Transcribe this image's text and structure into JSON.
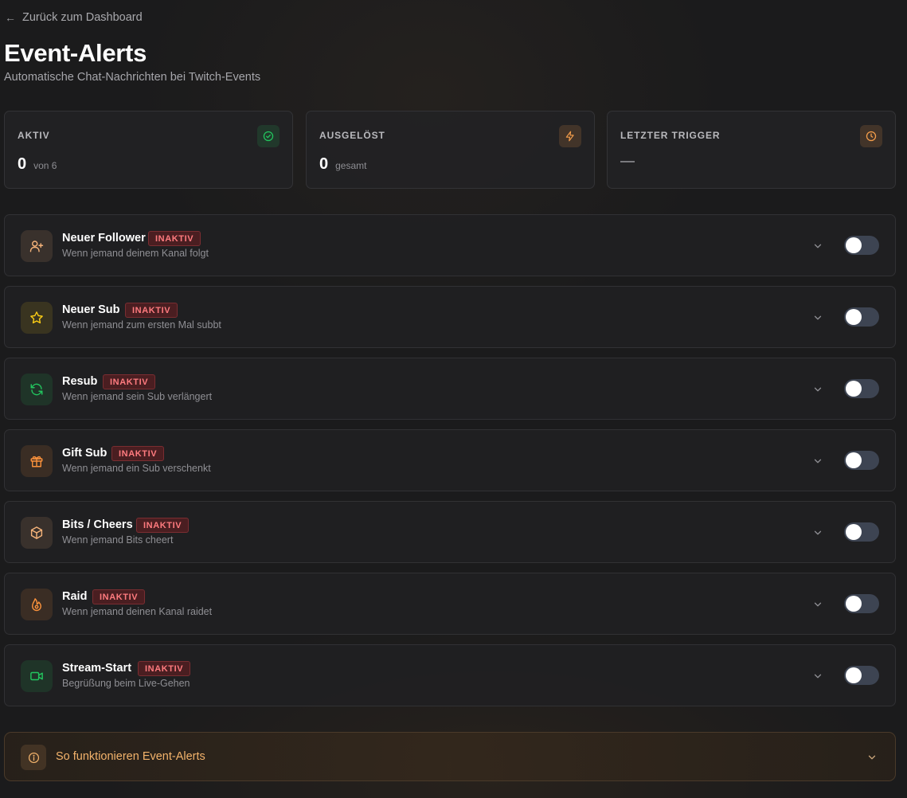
{
  "nav": {
    "back_label": "Zurück zum Dashboard",
    "back_arrow": "←"
  },
  "header": {
    "title": "Event-Alerts",
    "subtitle": "Automatische Chat-Nachrichten bei Twitch-Events"
  },
  "stats": [
    {
      "label": "AKTIV",
      "value": "0",
      "sub": "von 6",
      "icon": "check-circle-icon",
      "color": "#22c55e"
    },
    {
      "label": "AUSGELÖST",
      "value": "0",
      "sub": "gesamt",
      "icon": "lightning-icon",
      "color": "#f59e4b"
    },
    {
      "label": "LETZTER TRIGGER",
      "value": "—",
      "icon": "clock-icon",
      "color": "#f59e4b"
    }
  ],
  "alerts": [
    {
      "name": "Neuer Follower",
      "badge": "INAKTIV",
      "desc": "Wenn jemand deinem Kanal folgt",
      "icon": "user-plus-icon",
      "color": "#f5b37a",
      "enabled": false
    },
    {
      "name": "Neuer Sub",
      "badge": "INAKTIV",
      "desc": "Wenn jemand zum ersten Mal subbt",
      "icon": "star-icon",
      "color": "#facc15",
      "enabled": false
    },
    {
      "name": "Resub",
      "badge": "INAKTIV",
      "desc": "Wenn jemand sein Sub verlängert",
      "icon": "refresh-icon",
      "color": "#22c55e",
      "enabled": false
    },
    {
      "name": "Gift Sub",
      "badge": "INAKTIV",
      "desc": "Wenn jemand ein Sub verschenkt",
      "icon": "gift-icon",
      "color": "#fb923c",
      "enabled": false
    },
    {
      "name": "Bits / Cheers",
      "badge": "INAKTIV",
      "desc": "Wenn jemand Bits cheert",
      "icon": "box-icon",
      "color": "#f5b37a",
      "enabled": false
    },
    {
      "name": "Raid",
      "badge": "INAKTIV",
      "desc": "Wenn jemand deinen Kanal raidet",
      "icon": "flame-icon",
      "color": "#fb923c",
      "enabled": false
    },
    {
      "name": "Stream-Start",
      "badge": "INAKTIV",
      "desc": "Begrüßung beim Live-Gehen",
      "icon": "video-icon",
      "color": "#22c55e",
      "enabled": false
    }
  ],
  "info": {
    "label": "So funktionieren Event-Alerts",
    "icon": "info-icon"
  }
}
